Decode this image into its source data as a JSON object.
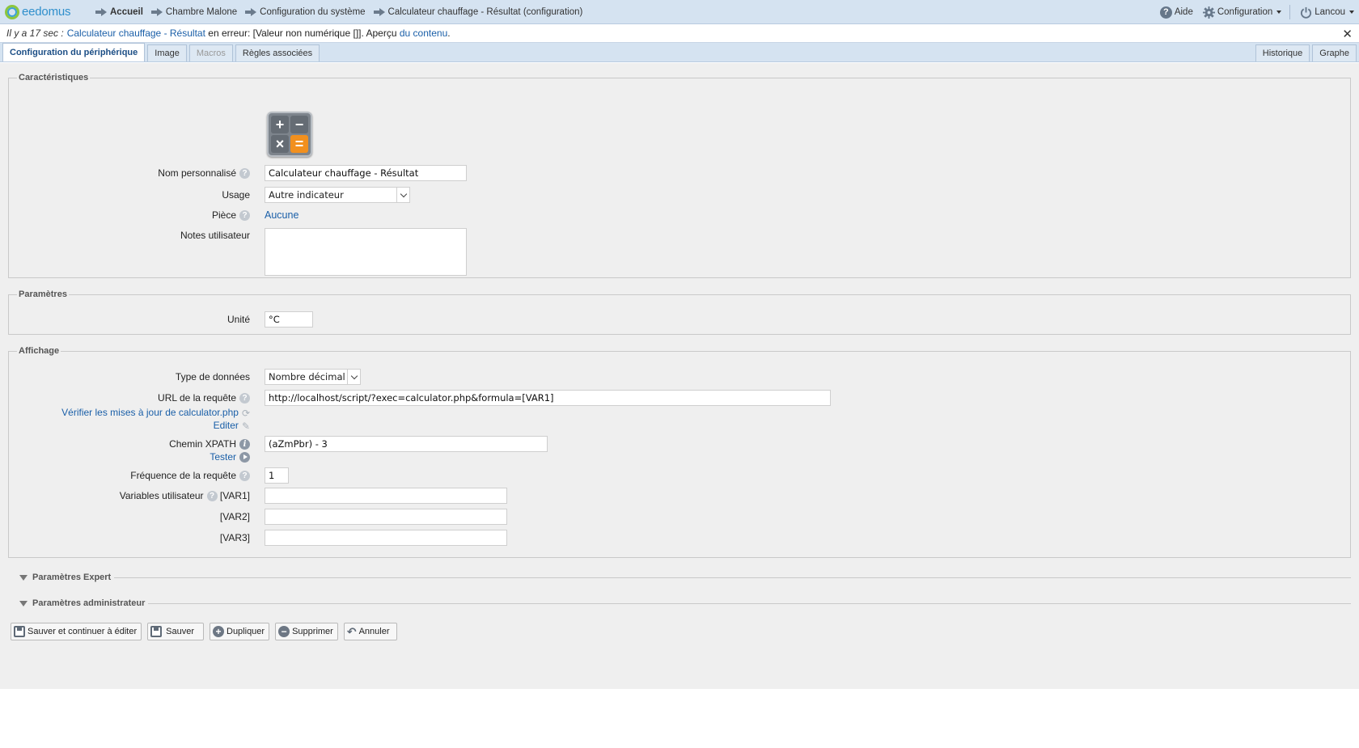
{
  "app": {
    "logo_text": "eedomus"
  },
  "breadcrumbs": [
    "Accueil",
    "Chambre Malone",
    "Configuration du système",
    "Calculateur chauffage - Résultat (configuration)"
  ],
  "topright": {
    "help": "Aide",
    "config": "Configuration",
    "user": "Lancou"
  },
  "notification": {
    "time": "Il y a 17 sec :",
    "link": "Calculateur chauffage - Résultat",
    "msg": "en erreur: [Valeur non numérique []]. Aperçu",
    "link2": "du contenu",
    "end": "."
  },
  "tabs": {
    "config": "Configuration du périphérique",
    "image": "Image",
    "macros": "Macros",
    "rules": "Règles associées",
    "history": "Historique",
    "graph": "Graphe"
  },
  "characteristics": {
    "legend": "Caractéristiques",
    "name_label": "Nom personnalisé",
    "name_value": "Calculateur chauffage - Résultat",
    "usage_label": "Usage",
    "usage_value": "Autre indicateur",
    "room_label": "Pièce",
    "room_value": "Aucune",
    "notes_label": "Notes utilisateur",
    "calc_glyphs": [
      "+",
      "−",
      "×",
      "="
    ]
  },
  "parameters": {
    "legend": "Paramètres",
    "unit_label": "Unité",
    "unit_value": "°C"
  },
  "display": {
    "legend": "Affichage",
    "type_label": "Type de données",
    "type_value": "Nombre décimal",
    "url_label": "URL de la requête",
    "url_value": "http://localhost/script/?exec=calculator.php&formula=[VAR1]",
    "check_updates": "Vérifier les mises à jour de calculator.php",
    "edit": "Editer",
    "xpath_label": "Chemin XPATH",
    "xpath_value": "(aZmPbr) - 3",
    "test": "Tester",
    "freq_label": "Fréquence de la requête",
    "freq_value": "1",
    "vars_label": "Variables utilisateur",
    "var1": "[VAR1]",
    "var2": "[VAR2]",
    "var3": "[VAR3]"
  },
  "collapsibles": {
    "expert": "Paramètres Expert",
    "admin": "Paramètres administrateur"
  },
  "buttons": {
    "save_continue": "Sauver et continuer à éditer",
    "save": "Sauver",
    "duplicate": "Dupliquer",
    "delete": "Supprimer",
    "cancel": "Annuler"
  }
}
